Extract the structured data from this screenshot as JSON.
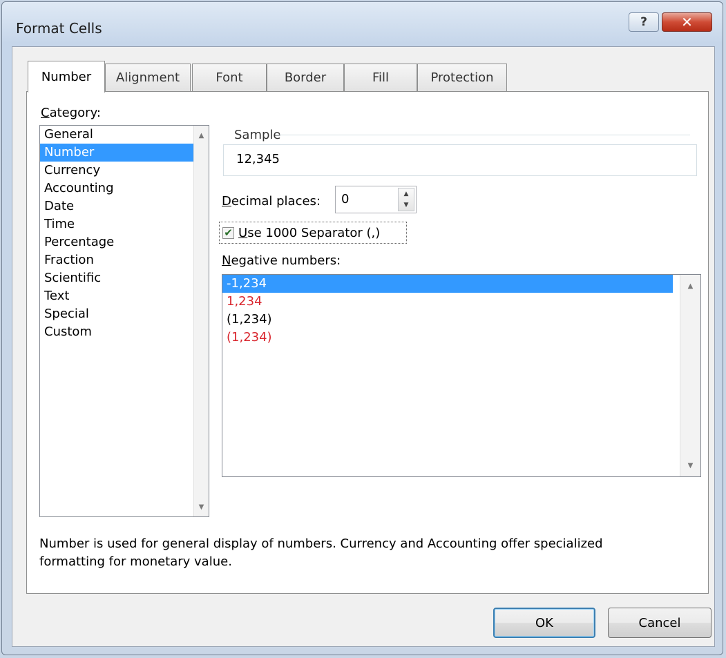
{
  "window": {
    "title": "Format Cells"
  },
  "title_buttons": {
    "help_icon": "?",
    "close_icon": "✕"
  },
  "tabs": [
    {
      "label": "Number",
      "active": true
    },
    {
      "label": "Alignment",
      "active": false
    },
    {
      "label": "Font",
      "active": false
    },
    {
      "label": "Border",
      "active": false
    },
    {
      "label": "Fill",
      "active": false
    },
    {
      "label": "Protection",
      "active": false
    }
  ],
  "category": {
    "label_hotkey": "C",
    "label_rest": "ategory:",
    "items": [
      "General",
      "Number",
      "Currency",
      "Accounting",
      "Date",
      "Time",
      "Percentage",
      "Fraction",
      "Scientific",
      "Text",
      "Special",
      "Custom"
    ],
    "selected": "Number"
  },
  "sample": {
    "label": "Sample",
    "value": "12,345"
  },
  "decimal_places": {
    "label_hotkey": "D",
    "label_rest": "ecimal places:",
    "value": "0"
  },
  "separator": {
    "checked": true,
    "check_glyph": "✔",
    "label_hotkey": "U",
    "label_rest": "se 1000 Separator (,)"
  },
  "negative_numbers": {
    "label_hotkey": "N",
    "label_rest": "egative numbers:",
    "items": [
      {
        "text": "-1,234",
        "color": "#ffffff",
        "selected": true
      },
      {
        "text": "1,234",
        "color": "#d9262e",
        "selected": false
      },
      {
        "text": "(1,234)",
        "color": "#000000",
        "selected": false
      },
      {
        "text": "(1,234)",
        "color": "#d9262e",
        "selected": false
      }
    ]
  },
  "description": "Number is used for general display of numbers.  Currency and Accounting offer specialized formatting for monetary value.",
  "buttons": {
    "ok": "OK",
    "cancel": "Cancel"
  },
  "colors": {
    "selection": "#3399ff",
    "negative_red": "#d9262e"
  },
  "icons": {
    "scroll_up": "scroll-up-arrow-icon",
    "scroll_down": "scroll-down-arrow-icon"
  }
}
